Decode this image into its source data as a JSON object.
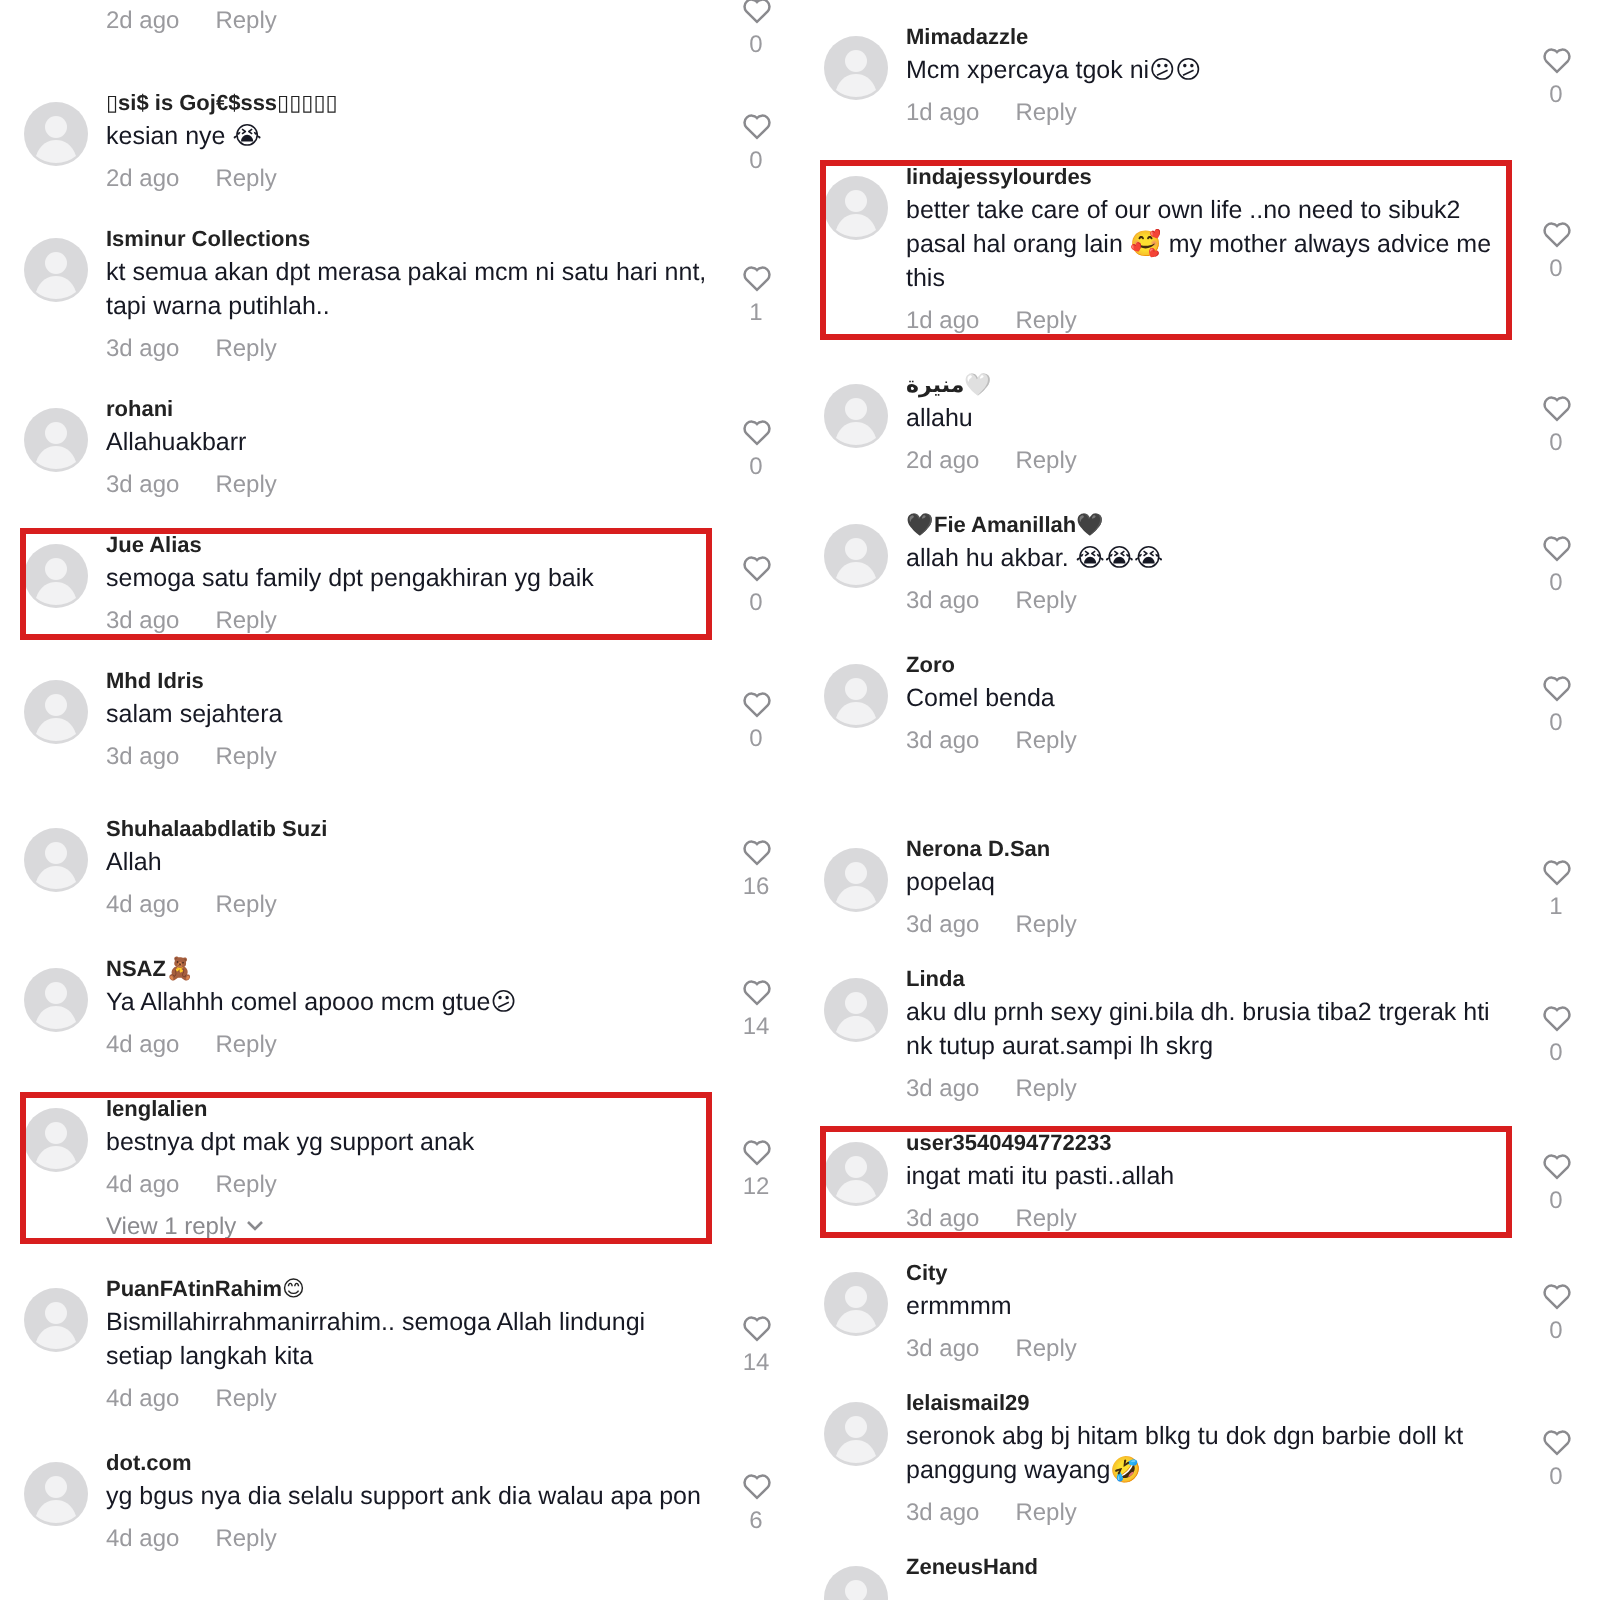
{
  "panels": [
    {
      "comments": [
        {
          "kind": "tail",
          "time": "2d ago",
          "reply": "Reply",
          "likes": "0",
          "highlighted": false
        },
        {
          "kind": "comment",
          "name": "▯si$ is Goj€$sss▯▯▯▯▯",
          "text": "kesian nye 😭",
          "time": "2d ago",
          "reply": "Reply",
          "likes": "0",
          "highlighted": false
        },
        {
          "kind": "comment",
          "name": "Isminur Collections",
          "text": "kt semua akan dpt merasa pakai mcm ni satu hari nnt, tapi warna putihlah..",
          "time": "3d ago",
          "reply": "Reply",
          "likes": "1",
          "highlighted": false
        },
        {
          "kind": "comment",
          "name": "rohani",
          "text": "Allahuakbarr",
          "time": "3d ago",
          "reply": "Reply",
          "likes": "0",
          "highlighted": false
        },
        {
          "kind": "comment",
          "name": "Jue Alias",
          "text": "semoga satu family dpt pengakhiran yg baik",
          "time": "3d ago",
          "reply": "Reply",
          "likes": "0",
          "highlighted": true
        },
        {
          "kind": "comment",
          "name": "Mhd Idris",
          "text": "salam sejahtera",
          "time": "3d ago",
          "reply": "Reply",
          "likes": "0",
          "highlighted": false
        }
      ]
    },
    {
      "comments": [
        {
          "kind": "comment",
          "name": "Shuhalaabdlatib Suzi",
          "text": "Allah",
          "time": "4d ago",
          "reply": "Reply",
          "likes": "16",
          "highlighted": false
        },
        {
          "kind": "comment",
          "name": "NSAZ🧸",
          "text": "Ya Allahhh comel apooo mcm gtue😕",
          "time": "4d ago",
          "reply": "Reply",
          "likes": "14",
          "highlighted": false
        },
        {
          "kind": "comment",
          "name": "lenglalien",
          "text": "bestnya dpt mak yg support anak",
          "time": "4d ago",
          "reply": "Reply",
          "likes": "12",
          "highlighted": true,
          "view_replies": "View 1 reply"
        },
        {
          "kind": "comment",
          "name": "PuanFAtinRahim😊",
          "text": "Bismillahirrahmanirrahim.. semoga Allah lindungi setiap langkah kita",
          "time": "4d ago",
          "reply": "Reply",
          "likes": "14",
          "highlighted": false
        },
        {
          "kind": "comment",
          "name": "dot.com",
          "text": "yg bgus nya dia selalu support ank dia walau apa pon",
          "time": "4d ago",
          "reply": "Reply",
          "likes": "6",
          "highlighted": false
        }
      ]
    },
    {
      "comments": [
        {
          "kind": "comment",
          "name": "Mimadazzle",
          "text": "Mcm xpercaya tgok ni😕😕",
          "time": "1d ago",
          "reply": "Reply",
          "likes": "0",
          "highlighted": false
        },
        {
          "kind": "comment",
          "name": "lindajessylourdes",
          "text": "better take care of our own life ..no need to sibuk2 pasal hal orang lain 🥰 my mother always advice me this",
          "time": "1d ago",
          "reply": "Reply",
          "likes": "0",
          "highlighted": true
        },
        {
          "kind": "comment",
          "name": "منيرة🤍",
          "text": "allahu",
          "time": "2d ago",
          "reply": "Reply",
          "likes": "0",
          "highlighted": false
        },
        {
          "kind": "comment",
          "name": "🖤Fie Amanillah🖤",
          "text": "allah hu akbar. 😭😭😭",
          "time": "3d ago",
          "reply": "Reply",
          "likes": "0",
          "highlighted": false
        },
        {
          "kind": "comment",
          "name": "Zoro",
          "text": "Comel benda",
          "time": "3d ago",
          "reply": "Reply",
          "likes": "0",
          "highlighted": false
        }
      ]
    },
    {
      "comments": [
        {
          "kind": "comment",
          "name": "Nerona D.San",
          "text": "popelaq",
          "time": "3d ago",
          "reply": "Reply",
          "likes": "1",
          "highlighted": false
        },
        {
          "kind": "comment",
          "name": "Linda",
          "text": "aku dlu prnh sexy gini.bila dh. brusia tiba2 trgerak hti nk tutup aurat.sampi lh skrg",
          "time": "3d ago",
          "reply": "Reply",
          "likes": "0",
          "highlighted": false
        },
        {
          "kind": "comment",
          "name": "user3540494772233",
          "text": "ingat mati itu pasti..allah",
          "time": "3d ago",
          "reply": "Reply",
          "likes": "0",
          "highlighted": true
        },
        {
          "kind": "comment",
          "name": "City",
          "text": "ermmmm",
          "time": "3d ago",
          "reply": "Reply",
          "likes": "0",
          "highlighted": false
        },
        {
          "kind": "comment",
          "name": "lelaismail29",
          "text": "seronok abg bj hitam blkg tu dok dgn barbie doll kt panggung wayang🤣",
          "time": "3d ago",
          "reply": "Reply",
          "likes": "0",
          "highlighted": false
        },
        {
          "kind": "cut",
          "name": "ZeneusHand",
          "highlighted": false
        }
      ]
    }
  ]
}
